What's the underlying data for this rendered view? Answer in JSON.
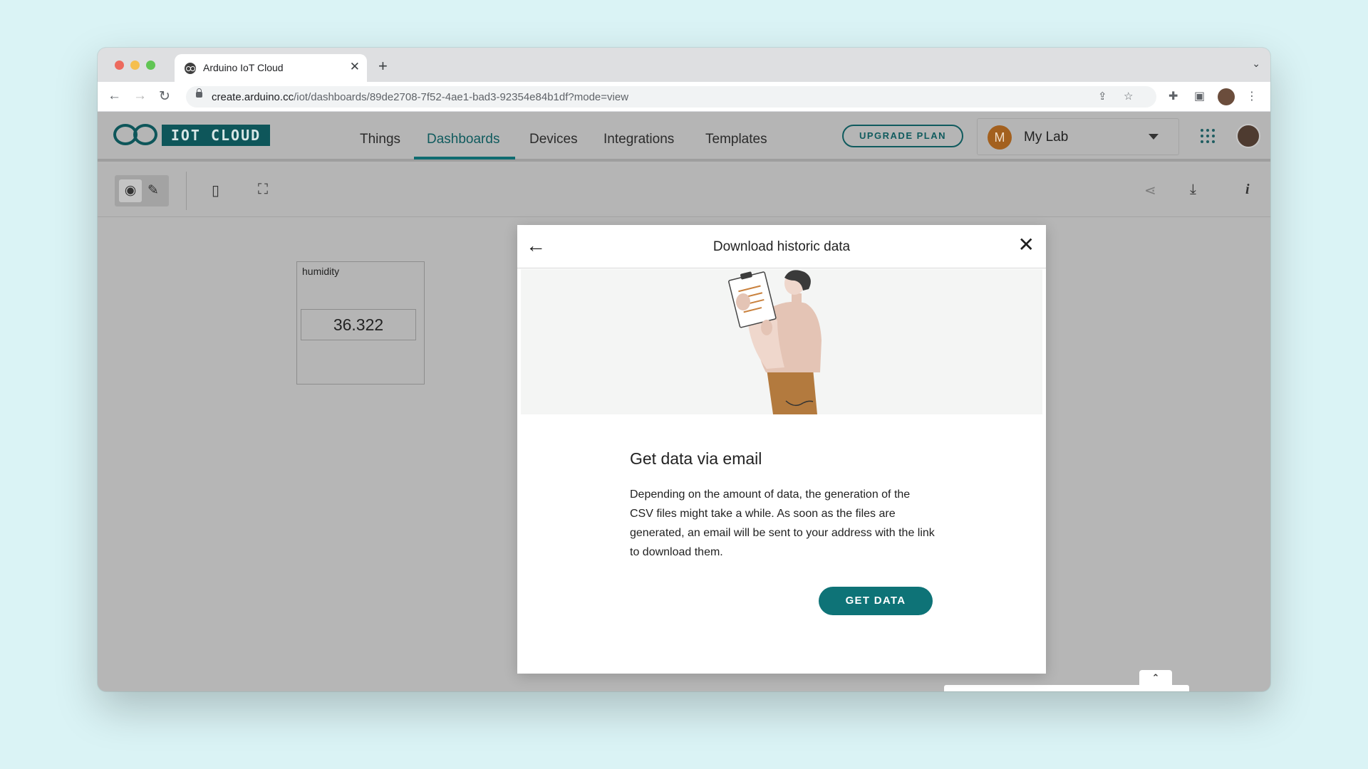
{
  "browser": {
    "tab_title": "Arduino IoT Cloud",
    "url_host": "create.arduino.cc",
    "url_path": "/iot/dashboards/89de2708-7f52-4ae1-bad3-92354e84b1df?mode=view"
  },
  "header": {
    "logo_text": "IOT CLOUD",
    "nav": {
      "things": "Things",
      "dashboards": "Dashboards",
      "devices": "Devices",
      "integrations": "Integrations",
      "templates": "Templates"
    },
    "active_nav": "Dashboards",
    "upgrade_label": "UPGRADE PLAN",
    "org": {
      "initial": "M",
      "name": "My Lab"
    }
  },
  "dashboard": {
    "widget": {
      "title": "humidity",
      "value": "36.322"
    }
  },
  "modal": {
    "title": "Download historic data",
    "section_title": "Get data via email",
    "section_text": "Depending on the amount of data, the generation of the CSV files might take a while. As soon as the files are generated, an email will be sent to your address with the link to download them.",
    "button_label": "GET DATA"
  },
  "colors": {
    "page_bg": "#daf3f5",
    "brand_teal": "#0e7377",
    "brand_dark": "#0e565a",
    "overlay_bg": "#b6b6b6"
  }
}
